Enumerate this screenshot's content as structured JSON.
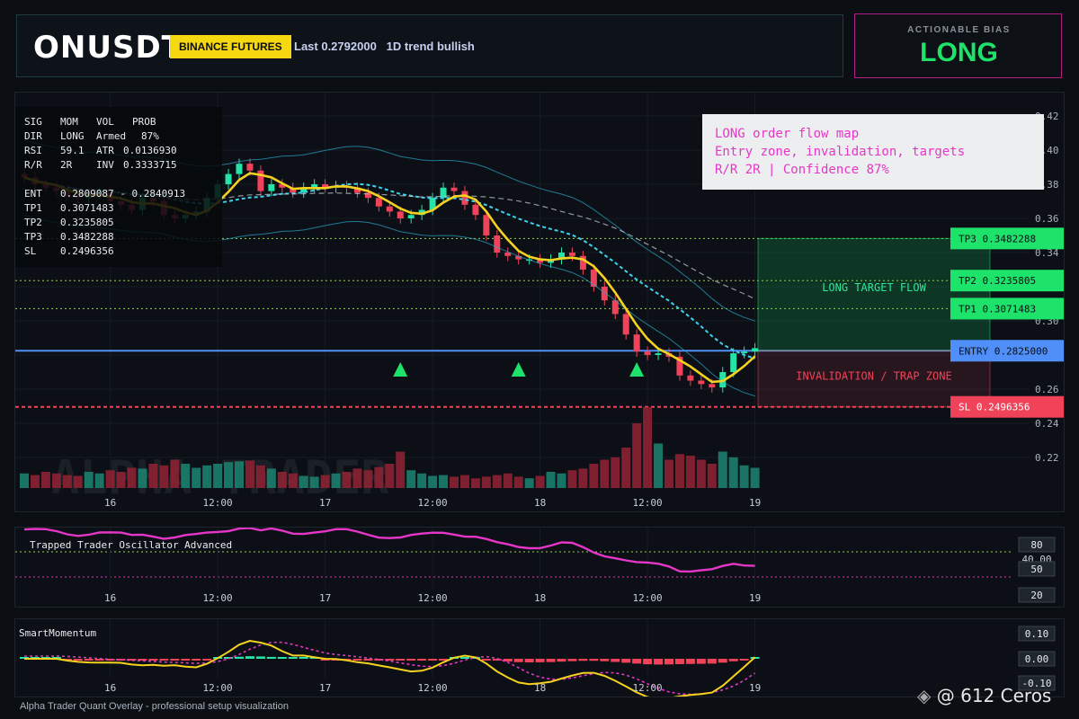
{
  "header": {
    "symbol": "ONUSDT",
    "exchange": "BINANCE FUTURES",
    "last_label": "Last 0.2792000",
    "trend_label": "1D trend bullish"
  },
  "bias": {
    "title": "ACTIONABLE BIAS",
    "value": "LONG",
    "color": "#1ee36b"
  },
  "stats": {
    "rows": [
      [
        "SIG",
        "MOM",
        "VOL",
        "PROB"
      ],
      [
        "DIR",
        "LONG",
        "Armed",
        "87%"
      ],
      [
        "RSI",
        "59.1",
        "ATR",
        "0.0136930"
      ],
      [
        "R/R",
        "2R",
        "INV",
        "0.3333715"
      ]
    ],
    "levels": [
      [
        "ENT",
        "0.2809087 - 0.2840913"
      ],
      [
        "TP1",
        "0.3071483"
      ],
      [
        "TP2",
        "0.3235805"
      ],
      [
        "TP3",
        "0.3482288"
      ],
      [
        "SL",
        "0.2496356"
      ]
    ]
  },
  "note": {
    "line1": "LONG order flow map",
    "line2": "Entry zone, invalidation, targets",
    "line3": "R/R 2R | Confidence 87%"
  },
  "zones": {
    "target_label": "LONG TARGET FLOW",
    "trap_label": "INVALIDATION / TRAP ZONE"
  },
  "watermark_text": "ALPHA TRADER",
  "price_tags": [
    {
      "label": "TP3 0.3482288",
      "price": 0.3482288,
      "bg": "#1ee36b",
      "fg": "#0b0f14"
    },
    {
      "label": "TP2 0.3235805",
      "price": 0.3235805,
      "bg": "#1ee36b",
      "fg": "#0b0f14"
    },
    {
      "label": "TP1 0.3071483",
      "price": 0.3071483,
      "bg": "#1ee36b",
      "fg": "#0b0f14"
    },
    {
      "label": "ENTRY 0.2825000",
      "price": 0.2825,
      "bg": "#4f8ff7",
      "fg": "#0b0f14"
    },
    {
      "label": "SL 0.2496356",
      "price": 0.2496356,
      "bg": "#f0435a",
      "fg": "#ffffff"
    }
  ],
  "chart_data": {
    "type": "candlestick",
    "y_ticks": [
      "0.42",
      "0.40",
      "0.38",
      "0.36",
      "0.34",
      "0.32",
      "0.30",
      "0.28",
      "0.26",
      "0.24",
      "0.22"
    ],
    "y_tick_values": [
      0.42,
      0.4,
      0.38,
      0.36,
      0.34,
      0.32,
      0.3,
      0.28,
      0.26,
      0.24,
      0.22
    ],
    "ylim": [
      0.205,
      0.425
    ],
    "x_tick_labels": [
      "16",
      "12:00",
      "17",
      "12:00",
      "18",
      "12:00",
      "19"
    ],
    "x_tick_bars": [
      8,
      18,
      28,
      38,
      48,
      58,
      68
    ],
    "bar_count": 69,
    "closes": [
      0.384,
      0.38,
      0.378,
      0.376,
      0.373,
      0.372,
      0.374,
      0.375,
      0.37,
      0.368,
      0.365,
      0.372,
      0.37,
      0.362,
      0.36,
      0.362,
      0.364,
      0.372,
      0.38,
      0.386,
      0.392,
      0.388,
      0.376,
      0.38,
      0.378,
      0.375,
      0.378,
      0.38,
      0.378,
      0.379,
      0.378,
      0.375,
      0.372,
      0.367,
      0.364,
      0.36,
      0.362,
      0.365,
      0.372,
      0.378,
      0.376,
      0.368,
      0.362,
      0.35,
      0.34,
      0.338,
      0.336,
      0.336,
      0.334,
      0.336,
      0.34,
      0.338,
      0.33,
      0.32,
      0.312,
      0.304,
      0.292,
      0.282,
      0.28,
      0.281,
      0.279,
      0.268,
      0.265,
      0.263,
      0.261,
      0.27,
      0.281,
      0.282,
      0.284
    ],
    "volumes": [
      0.18,
      0.16,
      0.2,
      0.18,
      0.16,
      0.15,
      0.2,
      0.18,
      0.22,
      0.2,
      0.25,
      0.24,
      0.3,
      0.28,
      0.35,
      0.3,
      0.25,
      0.28,
      0.3,
      0.32,
      0.33,
      0.34,
      0.28,
      0.24,
      0.2,
      0.18,
      0.15,
      0.14,
      0.16,
      0.18,
      0.2,
      0.24,
      0.22,
      0.26,
      0.3,
      0.45,
      0.22,
      0.18,
      0.15,
      0.16,
      0.14,
      0.16,
      0.12,
      0.14,
      0.16,
      0.18,
      0.14,
      0.12,
      0.15,
      0.2,
      0.18,
      0.22,
      0.24,
      0.3,
      0.35,
      0.38,
      0.5,
      0.8,
      1.0,
      0.55,
      0.35,
      0.42,
      0.4,
      0.35,
      0.3,
      0.45,
      0.38,
      0.28,
      0.25
    ],
    "indicators": {
      "oscillator": {
        "title": "Trapped Trader Oscillator Advanced",
        "levels": [
          "80",
          "40.00",
          "50",
          "20"
        ],
        "x_tick_labels": [
          "16",
          "12:00",
          "17",
          "12:00",
          "18",
          "12:00",
          "19"
        ]
      },
      "momentum": {
        "title": "SmartMomentum",
        "levels": [
          "0.10",
          "0.00",
          "-0.10"
        ],
        "x_tick_labels": [
          "16",
          "12:00",
          "17",
          "12:00",
          "18",
          "12:00",
          "19"
        ]
      }
    }
  },
  "footer": {
    "caption": "Alpha Trader Quant Overlay - professional setup visualization"
  },
  "credit": {
    "text": "@ 612 Ceros"
  }
}
